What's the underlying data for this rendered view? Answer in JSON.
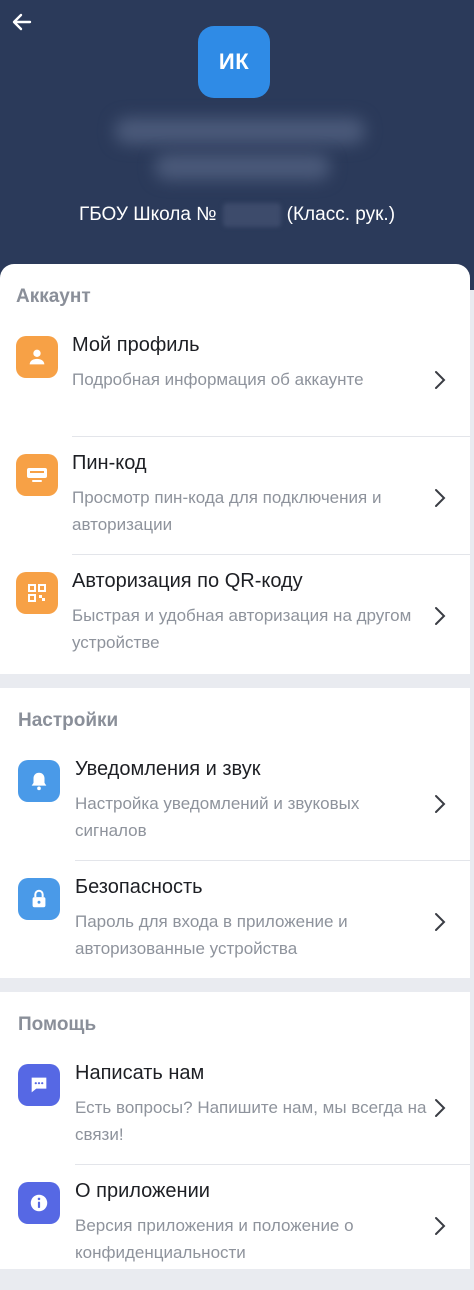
{
  "header": {
    "avatar_initials": "ИК",
    "school_prefix": "ГБОУ Школа №",
    "school_suffix": "(Класс. рук.)"
  },
  "sections": [
    {
      "title": "Аккаунт",
      "items": [
        {
          "title": "Мой профиль",
          "subtitle": "Подробная информация об аккаунте",
          "icon": "person-icon"
        },
        {
          "title": "Пин-код",
          "subtitle": "Просмотр пин-кода для подключения и авторизации",
          "icon": "keyboard-icon"
        },
        {
          "title": "Авторизация по QR-коду",
          "subtitle": "Быстрая и удобная авторизация на другом устройстве",
          "icon": "qr-code-icon"
        }
      ]
    },
    {
      "title": "Настройки",
      "items": [
        {
          "title": "Уведомления и звук",
          "subtitle": "Настройка уведомлений и звуковых сигналов",
          "icon": "bell-icon"
        },
        {
          "title": "Безопасность",
          "subtitle": "Пароль для входа в приложение и авторизованные устройства",
          "icon": "lock-icon"
        }
      ]
    },
    {
      "title": "Помощь",
      "items": [
        {
          "title": "Написать нам",
          "subtitle": "Есть вопросы? Напишите нам, мы всегда на связи!",
          "icon": "chat-icon"
        },
        {
          "title": "О приложении",
          "subtitle": "Версия приложения и положение о конфиденциальности",
          "icon": "info-icon"
        }
      ]
    }
  ],
  "colors": {
    "header_bg": "#2b3a5a",
    "avatar_bg": "#2f8be6",
    "account_icons": "#f7a146",
    "settings_icons": "#4a9ae8",
    "help_icons": "#5668e4"
  }
}
